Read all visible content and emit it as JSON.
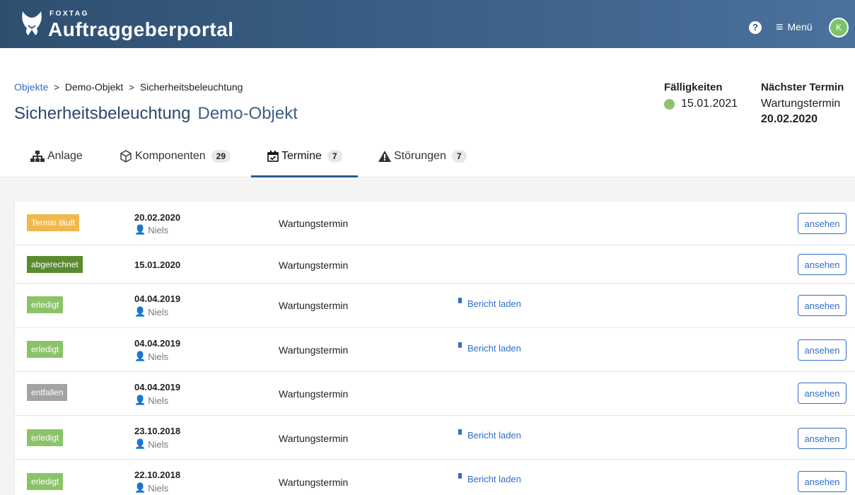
{
  "header": {
    "brand_small": "FOXTAG",
    "brand_title": "Auftraggeberportal",
    "help_icon": "question-circle-icon",
    "menu_label": "Menü",
    "avatar_initial": "K",
    "colors": {
      "bar": "#3b5f86",
      "avatar": "#7cc46a"
    }
  },
  "breadcrumb": {
    "root": "Objekte",
    "object": "Demo-Objekt",
    "current": "Sicherheitsbeleuchtung"
  },
  "page": {
    "title": "Sicherheitsbeleuchtung",
    "subtitle": "Demo-Objekt"
  },
  "due": {
    "heading": "Fälligkeiten",
    "date": "15.01.2021",
    "status_color": "#8cc36a"
  },
  "next": {
    "heading": "Nächster Termin",
    "type": "Wartungstermin",
    "date": "20.02.2020"
  },
  "tabs": [
    {
      "label": "Anlage",
      "icon": "sitemap-icon",
      "count": ""
    },
    {
      "label": "Komponenten",
      "icon": "cube-icon",
      "count": "29"
    },
    {
      "label": "Termine",
      "icon": "calendar-check-icon",
      "count": "7",
      "active": true
    },
    {
      "label": "Störungen",
      "icon": "warning-icon",
      "count": "7"
    }
  ],
  "appointments": [
    {
      "status": "Termin läuft",
      "status_color": "#f0b94e",
      "date": "20.02.2020",
      "person": "Niels",
      "type": "Wartungstermin",
      "report": "",
      "action": "ansehen"
    },
    {
      "status": "abgerechnet",
      "status_color": "#5a8a2e",
      "date": "15.01.2020",
      "person": "",
      "type": "Wartungstermin",
      "report": "",
      "action": "ansehen"
    },
    {
      "status": "erledigt",
      "status_color": "#8cc36a",
      "date": "04.04.2019",
      "person": "Niels",
      "type": "Wartungstermin",
      "report": "Bericht laden",
      "action": "ansehen"
    },
    {
      "status": "erledigt",
      "status_color": "#8cc36a",
      "date": "04.04.2019",
      "person": "Niels",
      "type": "Wartungstermin",
      "report": "Bericht laden",
      "action": "ansehen"
    },
    {
      "status": "entfallen",
      "status_color": "#a3a3a3",
      "date": "04.04.2019",
      "person": "Niels",
      "type": "Wartungstermin",
      "report": "",
      "action": "ansehen"
    },
    {
      "status": "erledigt",
      "status_color": "#8cc36a",
      "date": "23.10.2018",
      "person": "Niels",
      "type": "Wartungstermin",
      "report": "Bericht laden",
      "action": "ansehen"
    },
    {
      "status": "erledigt",
      "status_color": "#8cc36a",
      "date": "22.10.2018",
      "person": "Niels",
      "type": "Wartungstermin",
      "report": "Bericht laden",
      "action": "ansehen"
    }
  ]
}
